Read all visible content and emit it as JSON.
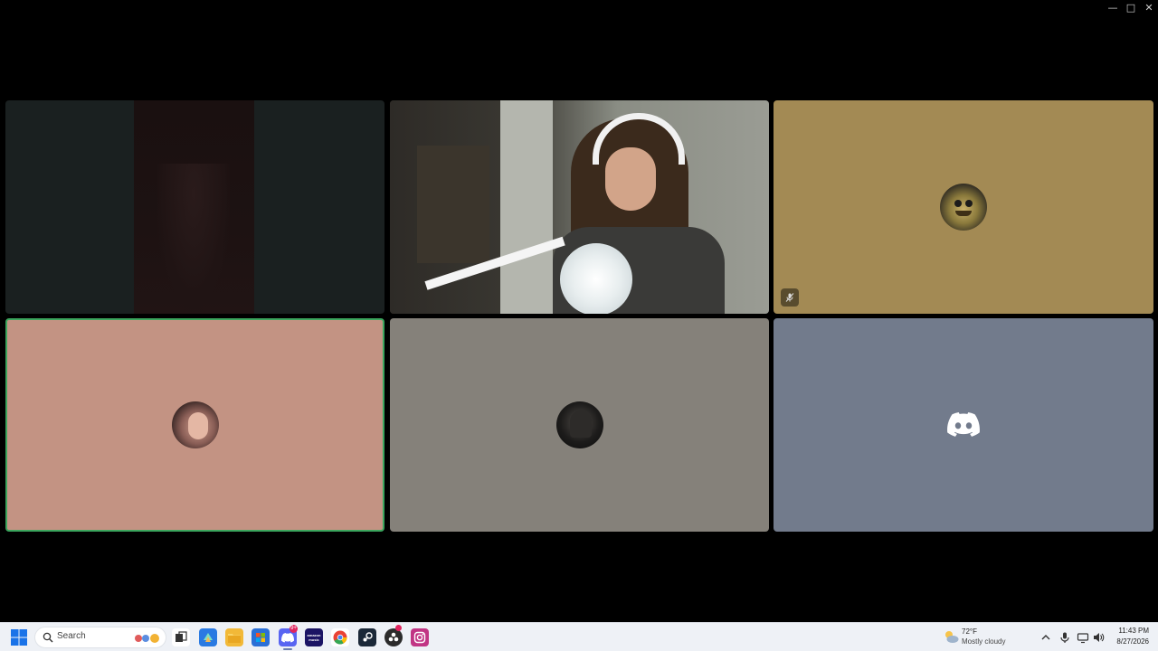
{
  "window": {
    "controls": [
      "minimize",
      "maximize",
      "close"
    ]
  },
  "tiles": [
    {
      "id": "participant-1",
      "kind": "video-dim"
    },
    {
      "id": "participant-2",
      "kind": "video-camera"
    },
    {
      "id": "participant-3",
      "kind": "avatar",
      "muted": true,
      "bg": "#a38a54"
    },
    {
      "id": "participant-4",
      "kind": "avatar",
      "speaking": true,
      "bg": "#c39383"
    },
    {
      "id": "participant-5",
      "kind": "avatar",
      "bg": "#85817a"
    },
    {
      "id": "participant-6",
      "kind": "default-avatar",
      "bg": "#727b8c"
    }
  ],
  "taskbar": {
    "search_label": "Search",
    "apps": [
      {
        "name": "task-view",
        "color": "#3a3a3a"
      },
      {
        "name": "copilot",
        "color": "#2a7ae2"
      },
      {
        "name": "file-explorer",
        "color": "#f2b938"
      },
      {
        "name": "microsoft-store",
        "color": "#2a6fd6"
      },
      {
        "name": "discord",
        "color": "#5865f2",
        "badge": "9+"
      },
      {
        "name": "amazon-music",
        "color": "#1b1464",
        "label": "amazon music"
      },
      {
        "name": "chrome",
        "color": "#e94235"
      },
      {
        "name": "steam",
        "color": "#1b2838"
      },
      {
        "name": "obs",
        "color": "#2b2b2b"
      },
      {
        "name": "instagram",
        "color": "#c13584"
      }
    ],
    "weather": {
      "temp": "72°F",
      "desc": "Mostly cloudy"
    },
    "clock": {
      "time": "11:43 PM",
      "date": "8/27/2026"
    }
  },
  "colors": {
    "speaking_border": "#3ba55d",
    "taskbar_bg": "#eef1f6",
    "discord_blurple": "#5865f2"
  }
}
